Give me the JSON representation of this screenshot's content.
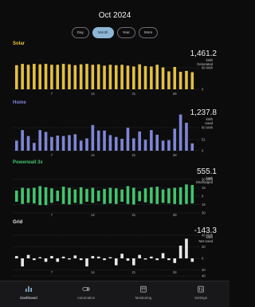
{
  "header": {
    "title": "Oct 2024"
  },
  "range_tabs": [
    {
      "label": "Day",
      "active": false
    },
    {
      "label": "Month",
      "active": true
    },
    {
      "label": "Year",
      "active": false
    },
    {
      "label": "More",
      "active": false
    }
  ],
  "sections": {
    "solar": {
      "title": "Solar",
      "color": "#e3c040",
      "value": "1,461.2",
      "unit_lines": [
        "kWh",
        "Generated"
      ],
      "ticks": [
        "80 kWh",
        "0"
      ]
    },
    "home": {
      "title": "Home",
      "color": "#7f86d6",
      "value": "1,237.8",
      "unit_lines": [
        "kWh",
        "Used"
      ],
      "ticks": [
        "80 kWh",
        "51",
        "0"
      ]
    },
    "powerwall": {
      "title": "Powerwall 3x",
      "color": "#43c46e",
      "value": "555.1",
      "unit_lines": [
        "kWh",
        "Discharged"
      ],
      "ticks": [
        "30 kWh",
        "15",
        "0",
        "15",
        "30"
      ]
    },
    "grid": {
      "title": "Grid",
      "color": "#e9e9e9",
      "value": "-143.3",
      "unit_lines": [
        "kWh",
        "Net Used"
      ],
      "ticks": [
        "40 kWh",
        "20",
        "0",
        "20",
        "40"
      ]
    }
  },
  "x_ticks": [
    "7",
    "14",
    "21",
    "28"
  ],
  "chart_data": [
    {
      "type": "bar",
      "title": "Solar",
      "x": [
        1,
        2,
        3,
        4,
        5,
        6,
        7,
        8,
        9,
        10,
        11,
        12,
        13,
        14,
        15,
        16,
        17,
        18,
        19,
        20,
        21,
        22,
        23,
        24,
        25,
        26,
        27,
        28,
        29,
        30,
        31
      ],
      "values": [
        55,
        58,
        56,
        58,
        57,
        58,
        56,
        56,
        58,
        57,
        55,
        57,
        58,
        56,
        57,
        54,
        56,
        55,
        56,
        54,
        52,
        57,
        53,
        52,
        56,
        50,
        41,
        51,
        40,
        42,
        39
      ],
      "ylim": [
        0,
        80
      ]
    },
    {
      "type": "bar",
      "title": "Home",
      "x": [
        1,
        2,
        3,
        4,
        5,
        6,
        7,
        8,
        9,
        10,
        11,
        12,
        13,
        14,
        15,
        16,
        17,
        18,
        19,
        20,
        21,
        22,
        23,
        24,
        25,
        26,
        27,
        28,
        29,
        30,
        31
      ],
      "values": [
        22,
        45,
        32,
        17,
        45,
        41,
        30,
        33,
        32,
        34,
        36,
        22,
        27,
        56,
        44,
        44,
        34,
        30,
        26,
        50,
        27,
        42,
        24,
        45,
        35,
        22,
        23,
        48,
        79,
        61,
        16
      ],
      "ylim": [
        0,
        80
      ]
    },
    {
      "type": "bar",
      "title": "Powerwall 3x",
      "x": [
        1,
        2,
        3,
        4,
        5,
        6,
        7,
        8,
        9,
        10,
        11,
        12,
        13,
        14,
        15,
        16,
        17,
        18,
        19,
        20,
        21,
        22,
        23,
        24,
        25,
        26,
        27,
        28,
        29,
        30,
        31
      ],
      "series": [
        {
          "values": [
            10,
            15,
            14,
            15,
            18,
            16,
            14,
            10,
            17,
            15,
            12,
            16,
            13,
            15,
            10,
            13,
            15,
            14,
            12,
            18,
            15,
            9,
            14,
            16,
            17,
            12,
            14,
            15,
            16,
            21,
            20
          ]
        },
        {
          "values": [
            -10,
            -14,
            -12,
            -13,
            -16,
            -16,
            -12,
            -9,
            -14,
            -15,
            -12,
            -14,
            -10,
            -12,
            -9,
            -14,
            -13,
            -14,
            -10,
            -14,
            -15,
            -9,
            -11,
            -13,
            -14,
            -12,
            -13,
            -14,
            -15,
            -14,
            -13
          ]
        }
      ],
      "ylim": [
        -30,
        30
      ]
    },
    {
      "type": "bar",
      "title": "Grid",
      "x": [
        1,
        2,
        3,
        4,
        5,
        6,
        7,
        8,
        9,
        10,
        11,
        12,
        13,
        14,
        15,
        16,
        17,
        18,
        19,
        20,
        21,
        22,
        23,
        24,
        25,
        26,
        27,
        28,
        29,
        30,
        31
      ],
      "values": [
        4,
        -14,
        6,
        -3,
        2,
        -6,
        4,
        -6,
        3,
        -2,
        5,
        -3,
        -14,
        4,
        3,
        -3,
        2,
        -12,
        8,
        -4,
        -12,
        6,
        -2,
        3,
        -3,
        9,
        -3,
        -8,
        22,
        34,
        -6
      ],
      "ylim": [
        -40,
        40
      ]
    }
  ],
  "tab_bar": [
    {
      "label": "Dashboard",
      "icon": "bar-chart-icon",
      "active": true
    },
    {
      "label": "Automation",
      "icon": "toggle-icon",
      "active": false
    },
    {
      "label": "Monitoring",
      "icon": "calendar-icon",
      "active": false
    },
    {
      "label": "Settings",
      "icon": "sliders-icon",
      "active": false
    }
  ]
}
